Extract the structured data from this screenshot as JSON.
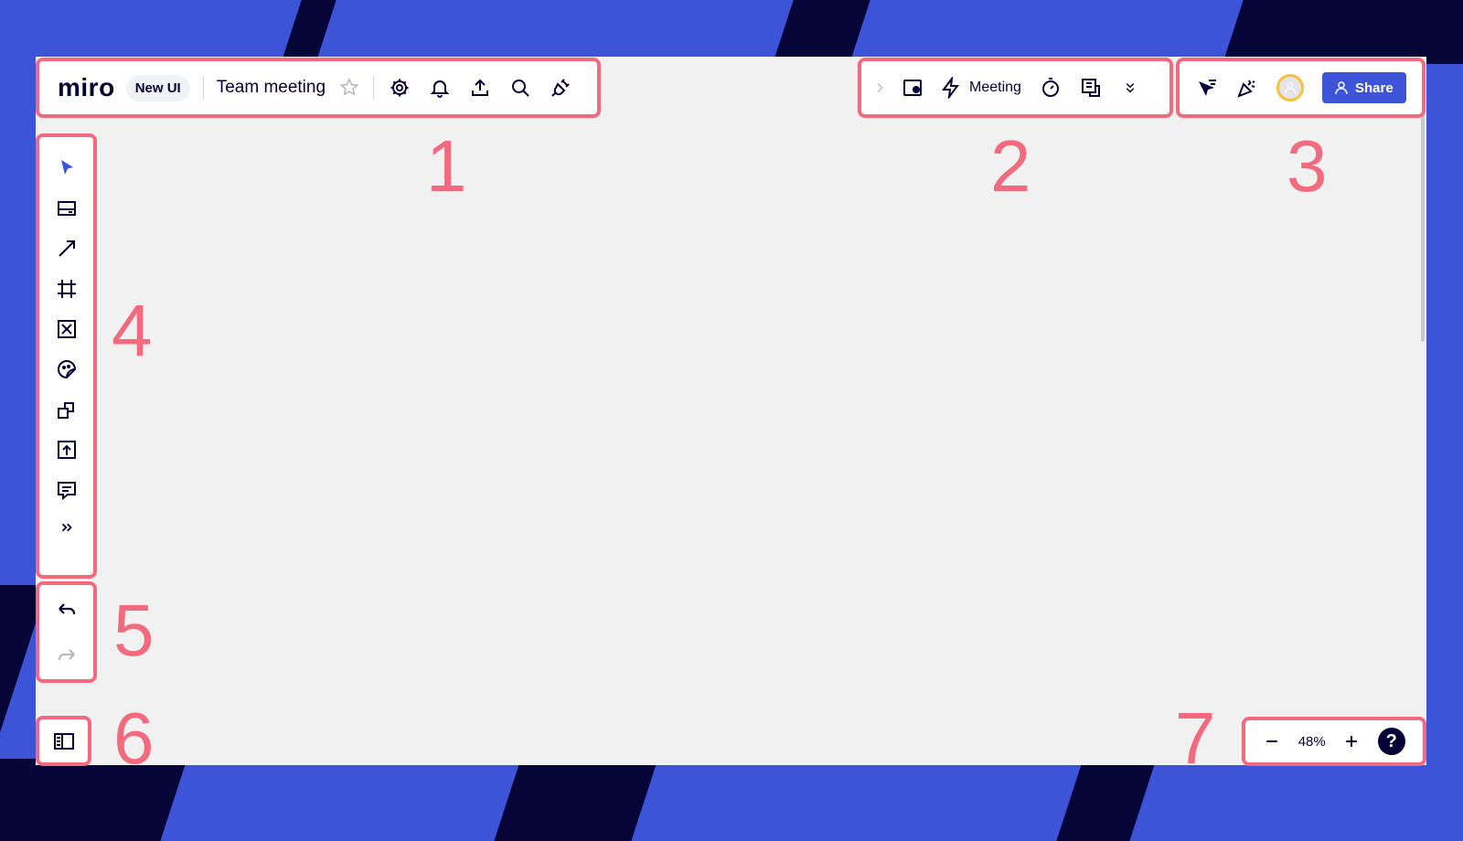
{
  "app": {
    "logo": "miro",
    "ui_badge": "New UI",
    "board_title": "Team meeting"
  },
  "top_right_center": {
    "meeting_label": "Meeting"
  },
  "collab": {
    "share_label": "Share"
  },
  "zoom": {
    "level": "48%",
    "help_label": "?"
  },
  "section_labels": [
    "1",
    "2",
    "3",
    "4",
    "5",
    "6",
    "7"
  ],
  "colors": {
    "accent": "#3d54d9",
    "highlight_border": "#f26a7e",
    "ink": "#050038",
    "canvas": "#f2f1f2",
    "avatar_ring": "#f5c33b"
  },
  "icons": {
    "left_toolbar": [
      "select-cursor-icon",
      "text-card-icon",
      "arrow-line-icon",
      "frame-icon",
      "placeholder-icon",
      "sticker-icon",
      "shapes-icon",
      "upload-icon",
      "comment-icon",
      "more-tools-icon"
    ],
    "history": [
      "undo-icon",
      "redo-icon"
    ],
    "top_bar": [
      "star-icon",
      "settings-gear-icon",
      "bell-icon",
      "export-icon",
      "search-icon",
      "plugin-icon"
    ],
    "center_bar": [
      "chevron-right-icon",
      "video-frame-icon",
      "lightning-icon",
      "timer-icon",
      "notes-icon",
      "double-chevron-down-icon"
    ],
    "right_bar": [
      "cursor-filter-icon",
      "celebration-icon",
      "avatar-icon",
      "person-icon"
    ]
  }
}
